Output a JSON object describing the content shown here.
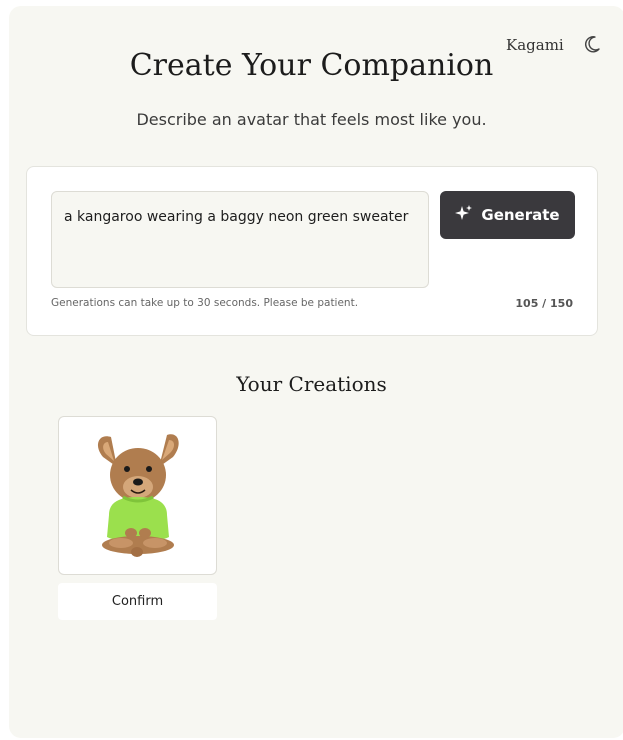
{
  "header": {
    "brand": "Kagami",
    "theme_icon": "moon-icon"
  },
  "hero": {
    "title": "Create Your Companion",
    "subtitle": "Describe an avatar that feels most like you."
  },
  "generator": {
    "prompt_value": "a kangaroo wearing a baggy neon green sweater",
    "generate_label": "Generate",
    "generate_icon": "sparkles-icon",
    "hint": "Generations can take up to 30 seconds. Please be patient.",
    "char_count": "105 / 150",
    "button_color": "#3a393d"
  },
  "creations": {
    "title": "Your Creations",
    "items": [
      {
        "image": "kangaroo-avatar-image",
        "confirm_label": "Confirm"
      }
    ]
  },
  "colors": {
    "background": "#f7f7f2",
    "panel": "#ffffff",
    "sweater": "#9be04d",
    "fur": "#b07d4f"
  }
}
